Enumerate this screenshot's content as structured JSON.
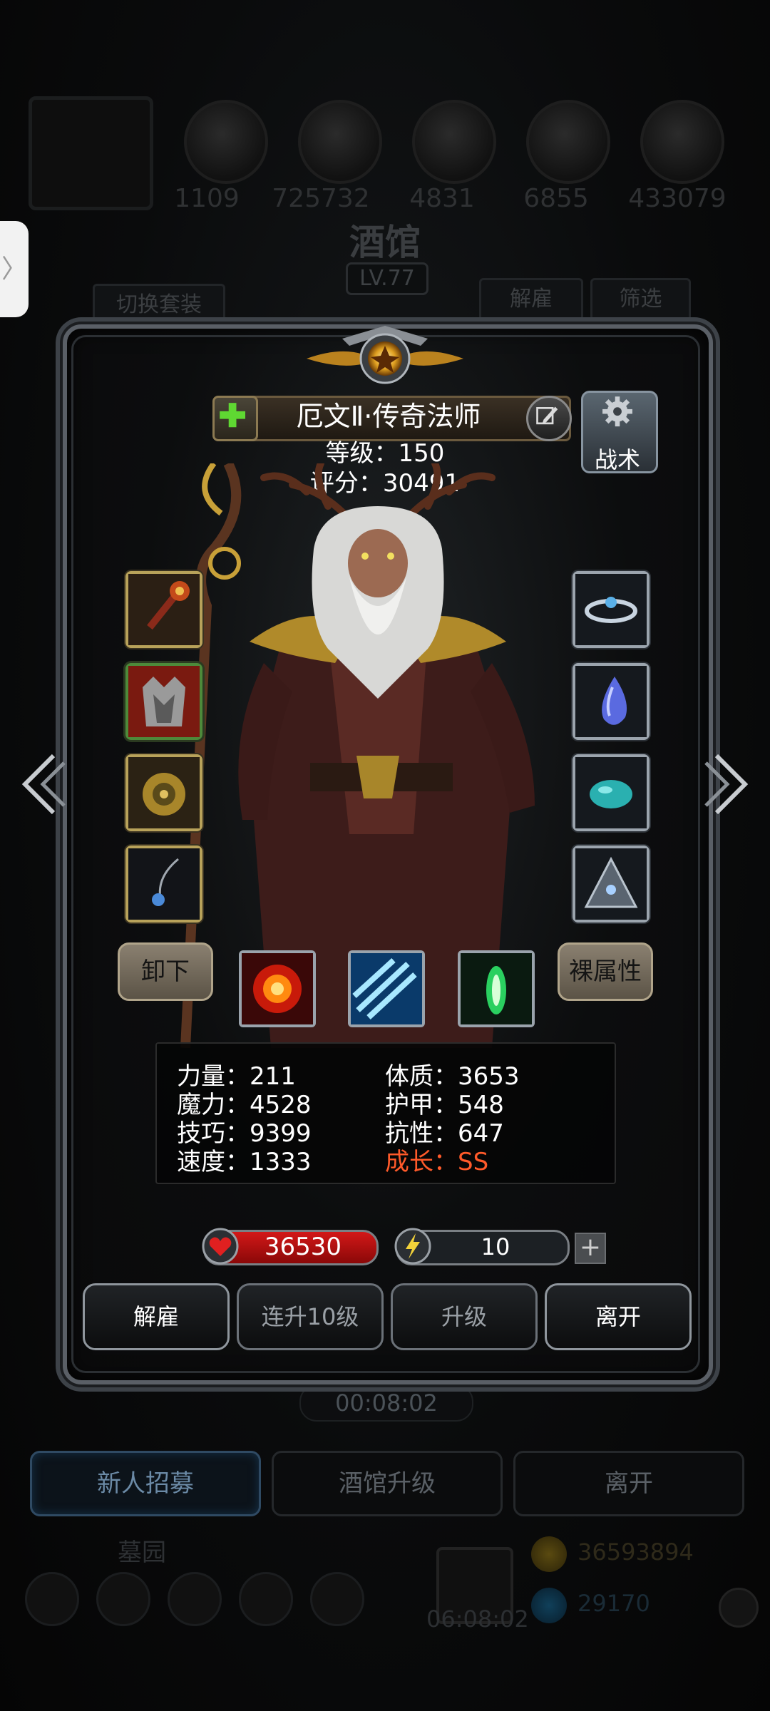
{
  "background": {
    "resources": [
      "1109",
      "725732",
      "4831",
      "6855",
      "433079"
    ],
    "tavern_title": "酒馆",
    "tavern_level": "LV.77",
    "switch_outfit": "切换套装",
    "dismiss": "解雇",
    "filter": "筛选",
    "timer": "00:08:02",
    "recruit": "新人招募",
    "upgrade_tavern": "酒馆升级",
    "leave": "离开",
    "cemetery": "墓园",
    "gift_timer": "06:08:02",
    "gold": "36593894",
    "gems": "29170"
  },
  "hero": {
    "name": "厄文Ⅱ·传奇法师",
    "level_line": "等级：150",
    "score_line": "评分：30491",
    "tactics_label": "战术",
    "unequip_label": "卸下",
    "base_attr_label": "裸属性"
  },
  "stats": {
    "strength": "力量：211",
    "magic": "魔力：4528",
    "skill": "技巧：9399",
    "speed": "速度：1333",
    "constitution": "体质：3653",
    "armor": "护甲：548",
    "resistance": "抗性：647",
    "growth": "成长：SS"
  },
  "vitals": {
    "hp": "36530",
    "energy": "10",
    "energy_fill": 0.1
  },
  "actions": {
    "dismiss": "解雇",
    "level_up_10": "连升10级",
    "level_up": "升级",
    "leave": "离开"
  },
  "colors": {
    "growth": "#ff5a2a",
    "hp": "#d31818",
    "energy": "#f2d23a"
  }
}
